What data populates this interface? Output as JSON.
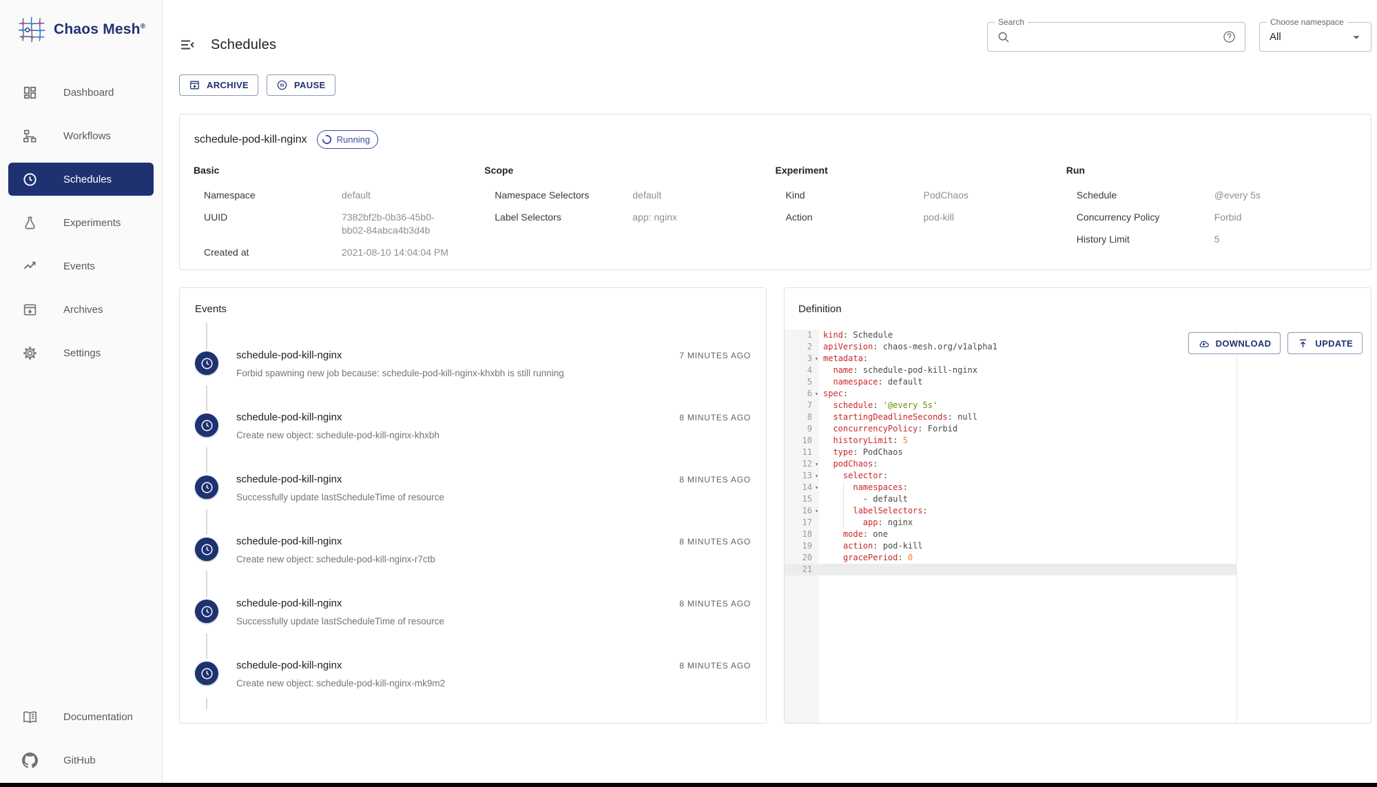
{
  "brand": {
    "name": "Chaos Mesh",
    "mark": "®"
  },
  "page": {
    "title": "Schedules"
  },
  "search": {
    "label": "Search"
  },
  "namespace": {
    "label": "Choose namespace",
    "value": "All"
  },
  "sidebar": {
    "items": [
      {
        "label": "Dashboard",
        "icon": "dashboard",
        "active": false
      },
      {
        "label": "Workflows",
        "icon": "workflows",
        "active": false
      },
      {
        "label": "Schedules",
        "icon": "clock",
        "active": true
      },
      {
        "label": "Experiments",
        "icon": "flask",
        "active": false
      },
      {
        "label": "Events",
        "icon": "trending",
        "active": false
      },
      {
        "label": "Archives",
        "icon": "archive",
        "active": false
      },
      {
        "label": "Settings",
        "icon": "gear",
        "active": false
      }
    ],
    "footer_items": [
      {
        "label": "Documentation",
        "icon": "book"
      },
      {
        "label": "GitHub",
        "icon": "github"
      }
    ]
  },
  "toolbar": {
    "archive_label": "ARCHIVE",
    "pause_label": "PAUSE"
  },
  "schedule": {
    "name": "schedule-pod-kill-nginx",
    "status": "Running",
    "sections": [
      {
        "title": "Basic",
        "rows": [
          [
            "Namespace",
            "default"
          ],
          [
            "UUID",
            "7382bf2b-0b36-45b0-\nbb02-84abca4b3d4b"
          ],
          [
            "Created at",
            "2021-08-10 14:04:04 PM"
          ]
        ]
      },
      {
        "title": "Scope",
        "rows": [
          [
            "Namespace Selectors",
            "default"
          ],
          [
            "Label Selectors",
            "app: nginx"
          ]
        ]
      },
      {
        "title": "Experiment",
        "rows": [
          [
            "Kind",
            "PodChaos"
          ],
          [
            "Action",
            "pod-kill"
          ]
        ]
      },
      {
        "title": "Run",
        "rows": [
          [
            "Schedule",
            "@every 5s"
          ],
          [
            "Concurrency Policy",
            "Forbid"
          ],
          [
            "History Limit",
            "5"
          ]
        ]
      }
    ]
  },
  "events": {
    "title": "Events",
    "items": [
      {
        "name": "schedule-pod-kill-nginx",
        "message": "Forbid spawning new job because: schedule-pod-kill-nginx-khxbh is still running",
        "time": "7 MINUTES AGO"
      },
      {
        "name": "schedule-pod-kill-nginx",
        "message": "Create new object: schedule-pod-kill-nginx-khxbh",
        "time": "8 MINUTES AGO"
      },
      {
        "name": "schedule-pod-kill-nginx",
        "message": "Successfully update lastScheduleTime of resource",
        "time": "8 MINUTES AGO"
      },
      {
        "name": "schedule-pod-kill-nginx",
        "message": "Create new object: schedule-pod-kill-nginx-r7ctb",
        "time": "8 MINUTES AGO"
      },
      {
        "name": "schedule-pod-kill-nginx",
        "message": "Successfully update lastScheduleTime of resource",
        "time": "8 MINUTES AGO"
      },
      {
        "name": "schedule-pod-kill-nginx",
        "message": "Create new object: schedule-pod-kill-nginx-mk9m2",
        "time": "8 MINUTES AGO"
      }
    ]
  },
  "definition": {
    "title": "Definition",
    "download_label": "DOWNLOAD",
    "update_label": "UPDATE",
    "code": {
      "lines": [
        {
          "n": 1,
          "fold": false,
          "tokens": [
            [
              "k",
              "kind"
            ],
            [
              "d",
              ": Schedule"
            ]
          ]
        },
        {
          "n": 2,
          "fold": false,
          "tokens": [
            [
              "k",
              "apiVersion"
            ],
            [
              "d",
              ": chaos-mesh.org/v1alpha1"
            ]
          ]
        },
        {
          "n": 3,
          "fold": true,
          "tokens": [
            [
              "k",
              "metadata"
            ],
            [
              "d",
              ":"
            ]
          ]
        },
        {
          "n": 4,
          "fold": false,
          "tokens": [
            [
              "d",
              "  "
            ],
            [
              "k",
              "name"
            ],
            [
              "d",
              ": schedule-pod-kill-nginx"
            ]
          ]
        },
        {
          "n": 5,
          "fold": false,
          "tokens": [
            [
              "d",
              "  "
            ],
            [
              "k",
              "namespace"
            ],
            [
              "d",
              ": default"
            ]
          ]
        },
        {
          "n": 6,
          "fold": true,
          "tokens": [
            [
              "k",
              "spec"
            ],
            [
              "d",
              ":"
            ]
          ]
        },
        {
          "n": 7,
          "fold": false,
          "tokens": [
            [
              "d",
              "  "
            ],
            [
              "k",
              "schedule"
            ],
            [
              "d",
              ": "
            ],
            [
              "s",
              "'@every 5s'"
            ]
          ]
        },
        {
          "n": 8,
          "fold": false,
          "tokens": [
            [
              "d",
              "  "
            ],
            [
              "k",
              "startingDeadlineSeconds"
            ],
            [
              "d",
              ": null"
            ]
          ]
        },
        {
          "n": 9,
          "fold": false,
          "tokens": [
            [
              "d",
              "  "
            ],
            [
              "k",
              "concurrencyPolicy"
            ],
            [
              "d",
              ": Forbid"
            ]
          ]
        },
        {
          "n": 10,
          "fold": false,
          "tokens": [
            [
              "d",
              "  "
            ],
            [
              "k",
              "historyLimit"
            ],
            [
              "d",
              ": "
            ],
            [
              "n",
              "5"
            ]
          ]
        },
        {
          "n": 11,
          "fold": false,
          "tokens": [
            [
              "d",
              "  "
            ],
            [
              "k",
              "type"
            ],
            [
              "d",
              ": PodChaos"
            ]
          ]
        },
        {
          "n": 12,
          "fold": true,
          "tokens": [
            [
              "d",
              "  "
            ],
            [
              "k",
              "podChaos"
            ],
            [
              "d",
              ":"
            ]
          ]
        },
        {
          "n": 13,
          "fold": true,
          "tokens": [
            [
              "d",
              "    "
            ],
            [
              "k",
              "selector"
            ],
            [
              "d",
              ":"
            ]
          ]
        },
        {
          "n": 14,
          "fold": true,
          "tokens": [
            [
              "d",
              "      "
            ],
            [
              "k",
              "namespaces"
            ],
            [
              "d",
              ":"
            ]
          ]
        },
        {
          "n": 15,
          "fold": false,
          "tokens": [
            [
              "d",
              "        - default"
            ]
          ]
        },
        {
          "n": 16,
          "fold": true,
          "tokens": [
            [
              "d",
              "      "
            ],
            [
              "k",
              "labelSelectors"
            ],
            [
              "d",
              ":"
            ]
          ]
        },
        {
          "n": 17,
          "fold": false,
          "tokens": [
            [
              "d",
              "        "
            ],
            [
              "k",
              "app"
            ],
            [
              "d",
              ": nginx"
            ]
          ]
        },
        {
          "n": 18,
          "fold": false,
          "tokens": [
            [
              "d",
              "    "
            ],
            [
              "k",
              "mode"
            ],
            [
              "d",
              ": one"
            ]
          ]
        },
        {
          "n": 19,
          "fold": false,
          "tokens": [
            [
              "d",
              "    "
            ],
            [
              "k",
              "action"
            ],
            [
              "d",
              ": pod-kill"
            ]
          ]
        },
        {
          "n": 20,
          "fold": false,
          "tokens": [
            [
              "d",
              "    "
            ],
            [
              "k",
              "gracePeriod"
            ],
            [
              "d",
              ": "
            ],
            [
              "n",
              "0"
            ]
          ]
        },
        {
          "n": 21,
          "fold": false,
          "current": true,
          "tokens": []
        }
      ]
    }
  },
  "colors": {
    "primary": "#1e3272",
    "key": "#c82829",
    "string": "#718c00",
    "number": "#f5871f"
  }
}
